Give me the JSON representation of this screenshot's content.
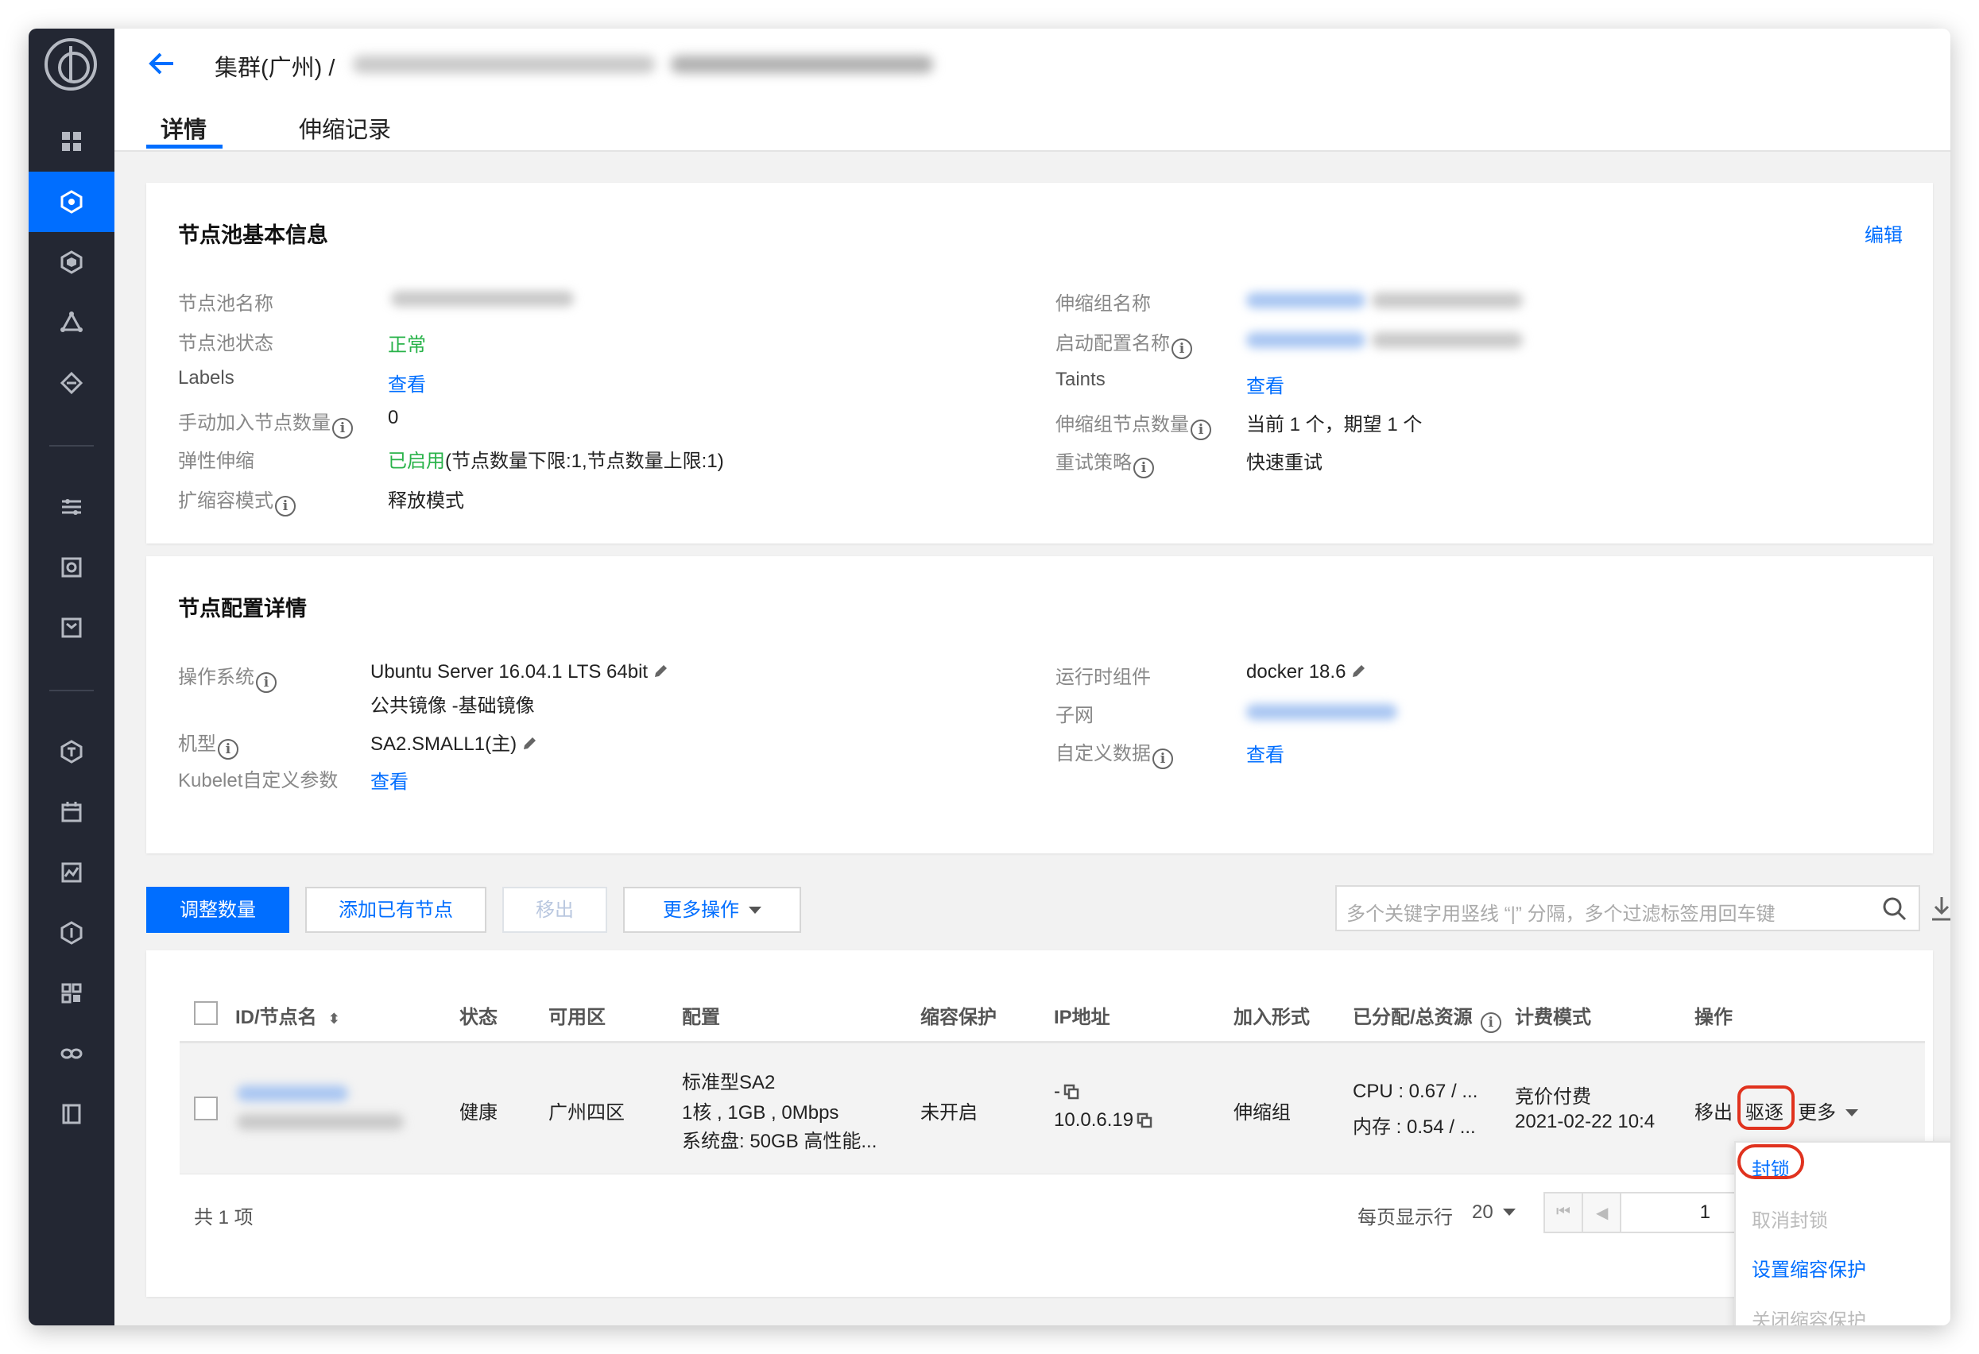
{
  "breadcrumb": {
    "cluster": "集群(广州)",
    "separator": "/"
  },
  "tabs": [
    {
      "label": "详情",
      "active": true
    },
    {
      "label": "伸缩记录",
      "active": false
    }
  ],
  "basic_info": {
    "title": "节点池基本信息",
    "edit_label": "编辑",
    "left": {
      "pool_name_label": "节点池名称",
      "pool_status_label": "节点池状态",
      "pool_status_value": "正常",
      "labels_label": "Labels",
      "labels_value": "查看",
      "manual_nodes_label": "手动加入节点数量",
      "manual_nodes_value": "0",
      "autoscale_label": "弹性伸缩",
      "autoscale_value": "已启用",
      "autoscale_detail": "(节点数量下限:1,节点数量上限:1)",
      "scale_mode_label": "扩缩容模式",
      "scale_mode_value": "释放模式"
    },
    "right": {
      "asg_name_label": "伸缩组名称",
      "launch_config_label": "启动配置名称",
      "taints_label": "Taints",
      "taints_value": "查看",
      "asg_nodes_label": "伸缩组节点数量",
      "asg_nodes_value": "当前 1 个，期望 1 个",
      "retry_label": "重试策略",
      "retry_value": "快速重试"
    }
  },
  "node_config": {
    "title": "节点配置详情",
    "os_label": "操作系统",
    "os_value": "Ubuntu Server 16.04.1 LTS 64bit",
    "os_image": "公共镜像 -基础镜像",
    "model_label": "机型",
    "model_value": "SA2.SMALL1(主)",
    "kubelet_label": "Kubelet自定义参数",
    "kubelet_value": "查看",
    "runtime_label": "运行时组件",
    "runtime_value": "docker 18.6",
    "subnet_label": "子网",
    "userdata_label": "自定义数据",
    "userdata_value": "查看"
  },
  "toolbar": {
    "adjust": "调整数量",
    "add_existing": "添加已有节点",
    "remove": "移出",
    "more_ops": "更多操作",
    "search_placeholder": "多个关键字用竖线 “|” 分隔，多个过滤标签用回车键"
  },
  "table": {
    "columns": [
      "ID/节点名",
      "状态",
      "可用区",
      "配置",
      "缩容保护",
      "IP地址",
      "加入形式",
      "已分配/总资源",
      "计费模式",
      "操作"
    ],
    "rows": [
      {
        "status": "健康",
        "zone": "广州四区",
        "config": [
          "标准型SA2",
          "1核 , 1GB , 0Mbps",
          "系统盘: 50GB 高性能..."
        ],
        "protection": "未开启",
        "ip_public": "-",
        "ip_private": "10.0.6.19",
        "join_type": "伸缩组",
        "cpu": "CPU : 0.67 / ...",
        "mem": "内存 : 0.54 / ...",
        "billing": "竞价付费",
        "billing_time": "2021-02-22 10:4",
        "actions": {
          "remove": "移出",
          "drain": "驱逐",
          "more": "更多"
        }
      }
    ],
    "total": "共 1 项"
  },
  "pagination": {
    "rows_label": "每页显示行",
    "page_size": "20",
    "current_page": "1"
  },
  "more_menu": [
    {
      "label": "封锁",
      "enabled": true
    },
    {
      "label": "取消封锁",
      "enabled": false
    },
    {
      "label": "设置缩容保护",
      "enabled": true
    },
    {
      "label": "关闭缩容保护",
      "enabled": false
    }
  ],
  "colors": {
    "accent": "#006eff",
    "healthy": "#29b34a",
    "sidebar": "#232733",
    "highlight": "#e0321e"
  }
}
